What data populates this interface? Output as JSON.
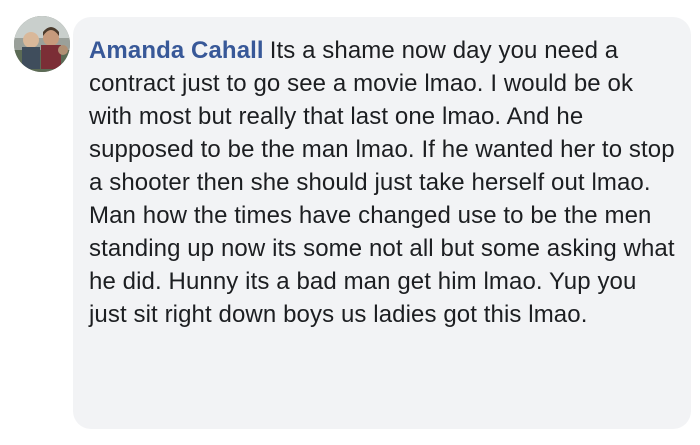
{
  "comment": {
    "author_name": "Amanda Cahall",
    "text": "Its a shame now day you need a contract just to go see a movie lmao. I would be ok with most but really that last one lmao. And he supposed to be the man lmao. If he wanted her to stop a shooter then she should just take herself out lmao. Man how the times have changed use to be the men standing up now its some not all but some asking what he did. Hunny its a bad man get him lmao. Yup you just sit right down boys us ladies got this lmao.",
    "avatar_icon": "user-avatar-photo"
  },
  "colors": {
    "author_name": "#385898",
    "bubble_background": "#f2f3f5",
    "text": "#1c1e21"
  }
}
